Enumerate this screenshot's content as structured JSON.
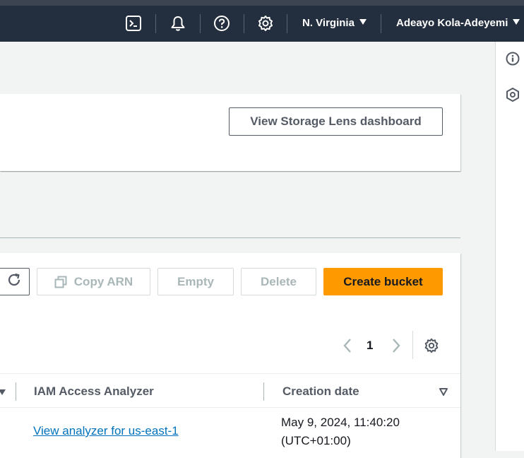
{
  "header": {
    "region_label": "N. Virginia",
    "user_label": "Adeayo Kola-Adeyemi",
    "icons": [
      "cloudshell-icon",
      "notifications-icon",
      "help-icon",
      "settings-icon"
    ]
  },
  "rail": {
    "icons": [
      "info-icon",
      "feedback-icon"
    ]
  },
  "storage_lens": {
    "button_label": "View Storage Lens dashboard"
  },
  "toolbar": {
    "copy_arn_label": "Copy ARN",
    "empty_label": "Empty",
    "delete_label": "Delete",
    "create_bucket_label": "Create bucket"
  },
  "pagination": {
    "current_page": "1"
  },
  "table": {
    "columns": [
      "IAM Access Analyzer",
      "Creation date"
    ],
    "rows": [
      {
        "iam_access_analyzer": "View analyzer for us-east-1",
        "creation_date_line1": "May 9, 2024, 11:40:20",
        "creation_date_line2": "(UTC+01:00)"
      }
    ]
  },
  "colors": {
    "topbar": "#232f3e",
    "primary": "#ff9900",
    "link": "#0073bb"
  }
}
